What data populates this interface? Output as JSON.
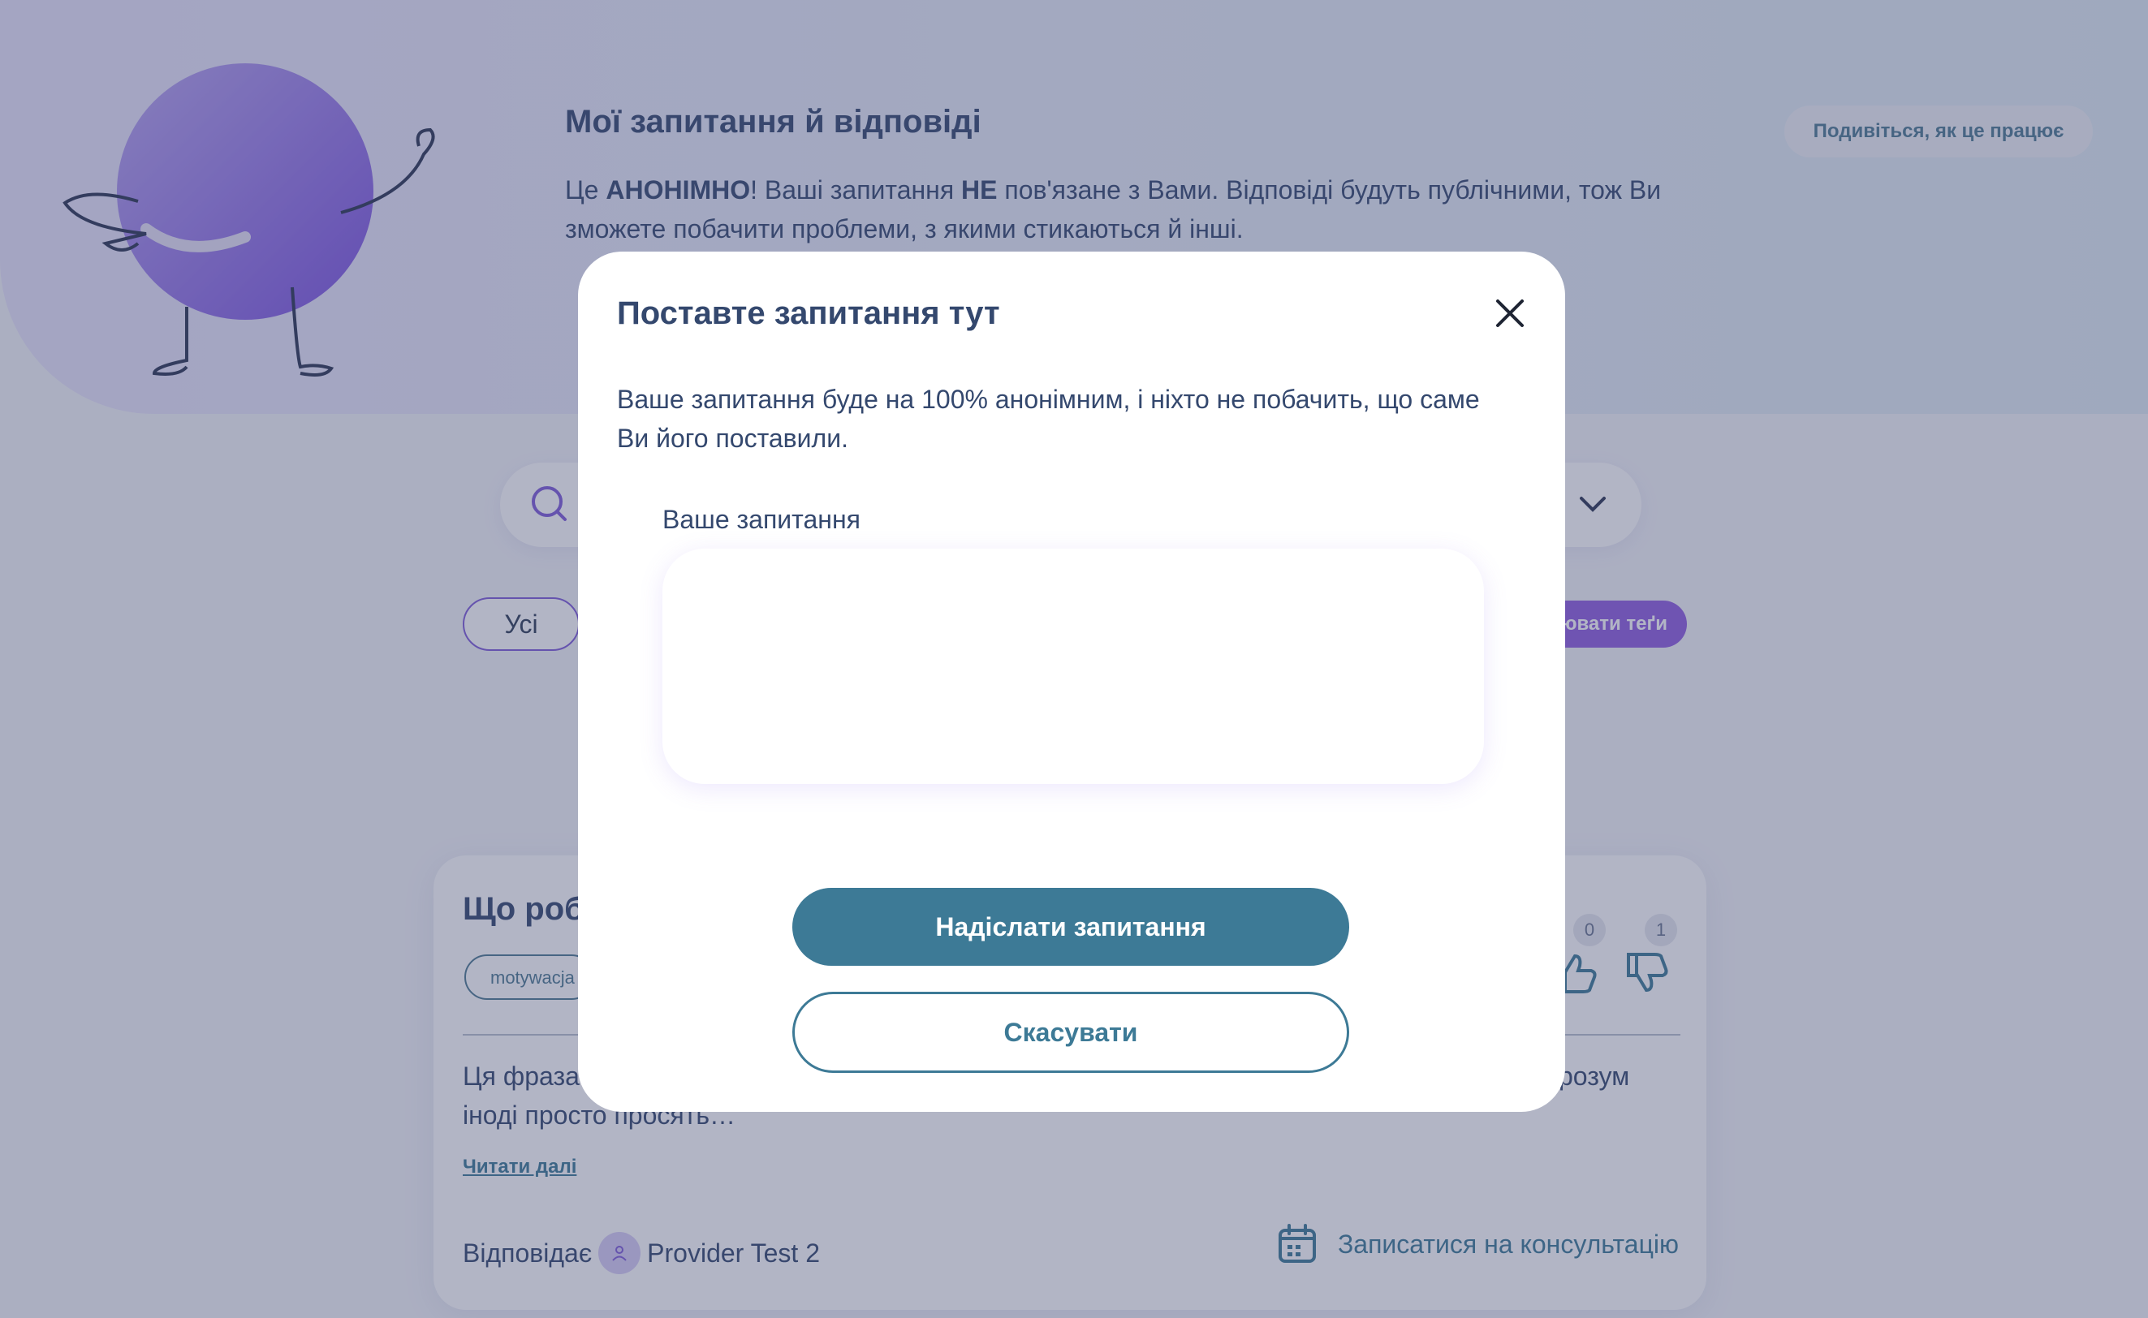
{
  "header": {
    "title": "Мої запитання й відповіді",
    "desc_part1": "Це ",
    "desc_bold1": "АНОНІМНО",
    "desc_part2": "! Ваші запитання ",
    "desc_bold2": "НЕ",
    "desc_part3": " пов'язане з Вами. Відповіді будуть публічними, тож Ви зможете побачити проблеми, з якими стикаються й інші.",
    "how_it_works": "Подивіться, як це працює"
  },
  "filters": {
    "all_label": "Усі",
    "edit_tags_label": "ювати теґи"
  },
  "card": {
    "title": "Що роб",
    "tag": "motywacja",
    "likes": "0",
    "dislikes": "1",
    "body": "Ця фраза … нтаження або просто тимчасового занепаду сил. І це нормально. Наше тіло і розум іноді просто просять…",
    "read_more": "Читати далі",
    "answered_by_label": "Відповідає",
    "provider_name": "Provider Test 2",
    "consultation_label": "Записатися на консультацію"
  },
  "modal": {
    "title": "Поставте запитання тут",
    "description": "Ваше запитання буде на 100% анонімним, і ніхто не побачить, що саме Ви його поставили.",
    "field_label": "Ваше запитання",
    "field_value": "",
    "send_label": "Надіслати запитання",
    "cancel_label": "Скасувати"
  },
  "colors": {
    "accent_teal": "#3d7a96",
    "accent_purple": "#8f5ee0",
    "text_dark": "#34486e"
  },
  "icons": [
    "mascot-illustration",
    "search-icon",
    "chevron-down-icon",
    "thumbs-up-icon",
    "thumbs-down-icon",
    "user-icon",
    "calendar-icon",
    "close-icon"
  ]
}
